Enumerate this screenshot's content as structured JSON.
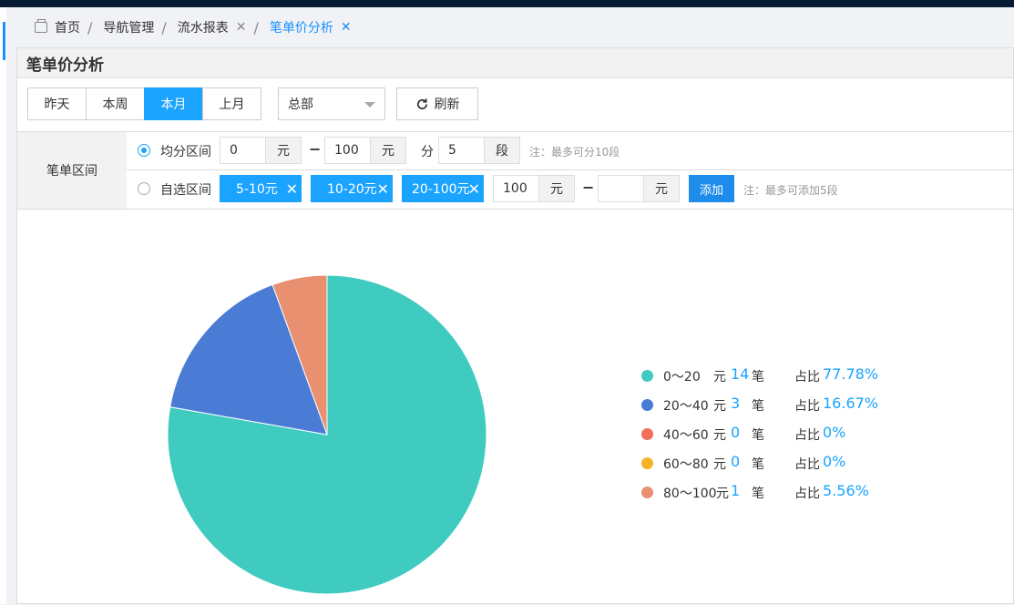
{
  "breadcrumb": {
    "home": "首页",
    "items": [
      "导航管理",
      "流水报表"
    ],
    "current": "笔单价分析",
    "close": "✕",
    "sep": "/"
  },
  "panel": {
    "title": "笔单价分析"
  },
  "toolbar": {
    "periods": [
      "昨天",
      "本周",
      "本月",
      "上月"
    ],
    "active_period": "本月",
    "store_select": "总部",
    "refresh_label": "刷新"
  },
  "filter": {
    "label": "笔单区间",
    "even": {
      "label": "均分区间",
      "selected": true,
      "min": "0",
      "max": "100",
      "unit": "元",
      "dash": "−",
      "split_label": "分",
      "segments": "5",
      "segment_unit": "段",
      "note": "注：最多可分10段"
    },
    "custom": {
      "label": "自选区间",
      "selected": false,
      "tags": [
        "5-10元",
        "10-20元",
        "20-100元"
      ],
      "tag_close": "✕",
      "min": "100",
      "max": "",
      "unit": "元",
      "add_label": "添加",
      "note": "注：最多可添加5段"
    }
  },
  "chart_data": {
    "type": "pie",
    "legend_position": "right",
    "unit_yuan": "元",
    "unit_bi": "笔",
    "ratio_label": "占比",
    "slices": [
      {
        "range": "0～20",
        "count": 14,
        "percent": "77.78%",
        "value": 77.78,
        "color": "#40cbc0"
      },
      {
        "range": "20～40",
        "count": 3,
        "percent": "16.67%",
        "value": 16.67,
        "color": "#4a7cd6"
      },
      {
        "range": "40～60",
        "count": 0,
        "percent": "0%",
        "value": 0,
        "color": "#f26d5b"
      },
      {
        "range": "60～80",
        "count": 0,
        "percent": "0%",
        "value": 0,
        "color": "#f6b226"
      },
      {
        "range": "80～100",
        "count": 1,
        "percent": "5.56%",
        "value": 5.56,
        "color": "#e8906f"
      }
    ]
  }
}
